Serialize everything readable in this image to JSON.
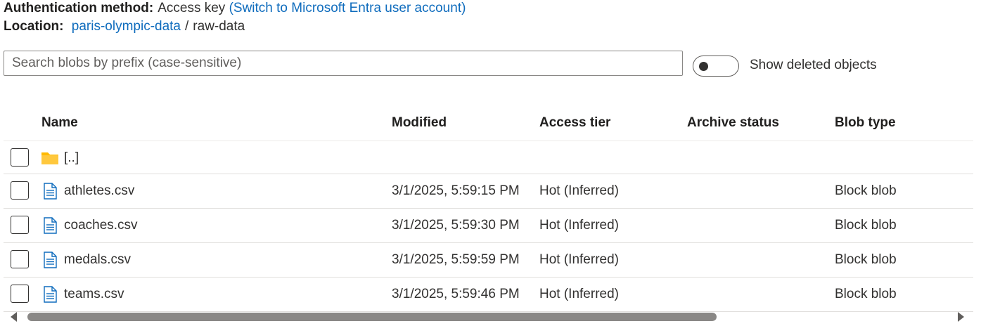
{
  "header": {
    "auth_label": "Authentication method:",
    "auth_value": "Access key",
    "auth_link": "(Switch to Microsoft Entra user account)",
    "location_label": "Location:",
    "location_container": "paris-olympic-data",
    "location_separator": "/",
    "location_folder": "raw-data"
  },
  "search": {
    "placeholder": "Search blobs by prefix (case-sensitive)",
    "value": ""
  },
  "toggle": {
    "label": "Show deleted objects",
    "checked": false
  },
  "table": {
    "columns": [
      "Name",
      "Modified",
      "Access tier",
      "Archive status",
      "Blob type"
    ],
    "rows": [
      {
        "icon": "folder-icon",
        "name": "[..]",
        "modified": "",
        "tier": "",
        "archive": "",
        "type": ""
      },
      {
        "icon": "file-icon",
        "name": "athletes.csv",
        "modified": "3/1/2025, 5:59:15 PM",
        "tier": "Hot (Inferred)",
        "archive": "",
        "type": "Block blob"
      },
      {
        "icon": "file-icon",
        "name": "coaches.csv",
        "modified": "3/1/2025, 5:59:30 PM",
        "tier": "Hot (Inferred)",
        "archive": "",
        "type": "Block blob"
      },
      {
        "icon": "file-icon",
        "name": "medals.csv",
        "modified": "3/1/2025, 5:59:59 PM",
        "tier": "Hot (Inferred)",
        "archive": "",
        "type": "Block blob"
      },
      {
        "icon": "file-icon",
        "name": "teams.csv",
        "modified": "3/1/2025, 5:59:46 PM",
        "tier": "Hot (Inferred)",
        "archive": "",
        "type": "Block blob"
      }
    ]
  },
  "colors": {
    "link": "#0f6cbd",
    "folder": "#ffb900",
    "file": "#0f6cbd"
  }
}
